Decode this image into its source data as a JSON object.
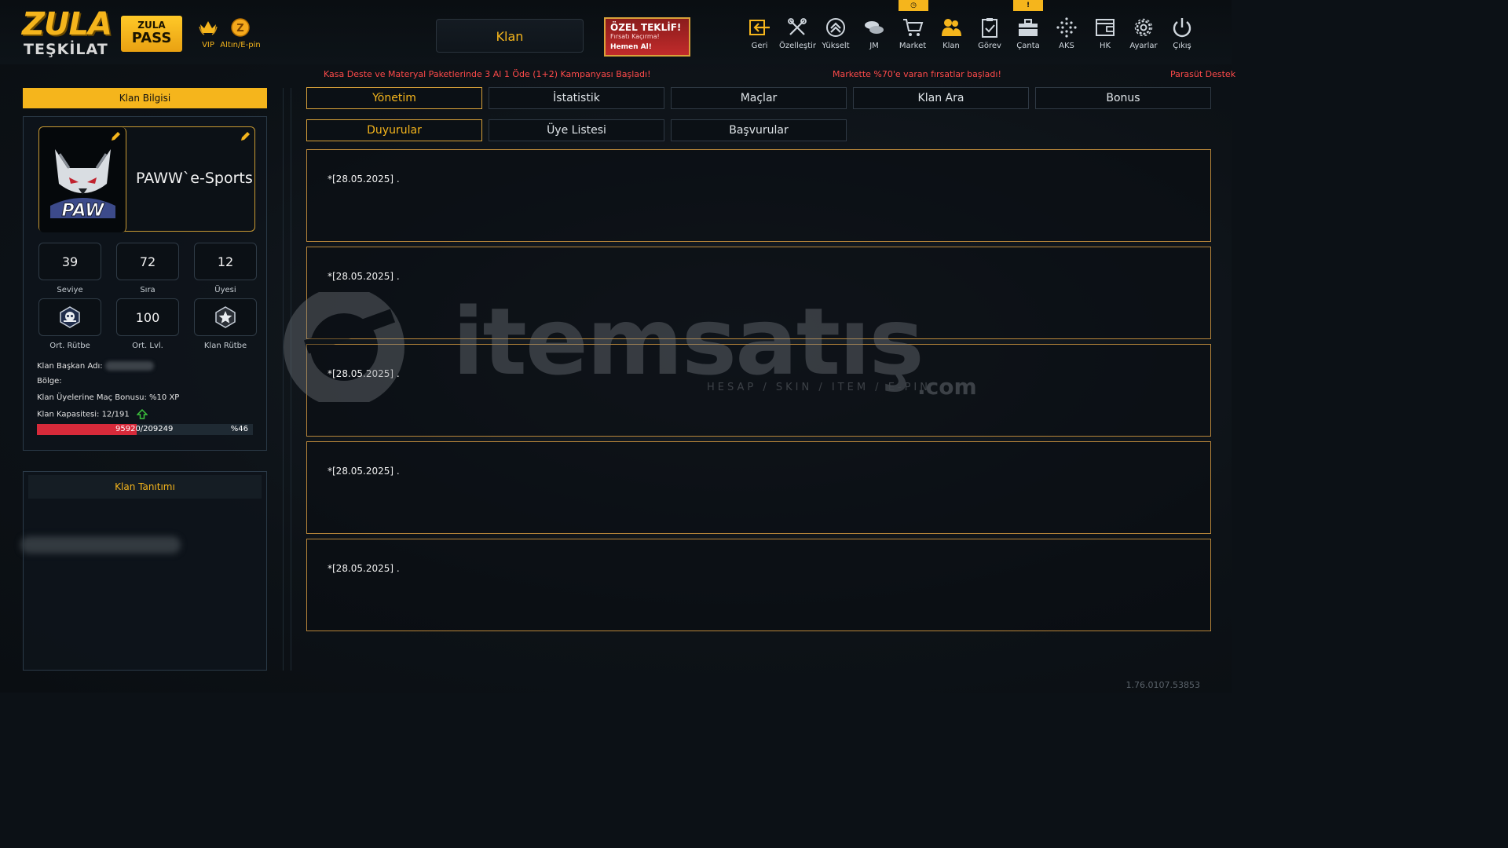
{
  "header": {
    "logo_line1": "ZULA",
    "logo_line2": "TEŞKİLAT",
    "zula_pass_line1": "ZULA",
    "zula_pass_line2": "PASS",
    "vip_label": "VIP",
    "gold_label": "Altın/E-pin",
    "page_title": "Klan",
    "offer_title": "ÖZEL TEKLİF!",
    "offer_subtitle": "Fırsatı Kaçırma!",
    "offer_cta": "Hemen Al!",
    "nav": [
      {
        "label": "Geri",
        "icon": "back-arrow-icon"
      },
      {
        "label": "Özelleştir",
        "icon": "tools-icon"
      },
      {
        "label": "Yükselt",
        "icon": "rank-up-icon"
      },
      {
        "label": "JM",
        "icon": "coins-icon"
      },
      {
        "label": "Market",
        "icon": "cart-icon"
      },
      {
        "label": "Klan",
        "icon": "clan-icon"
      },
      {
        "label": "Görev",
        "icon": "clipboard-icon"
      },
      {
        "label": "Çanta",
        "icon": "bag-icon"
      },
      {
        "label": "AKS",
        "icon": "dots-icon"
      },
      {
        "label": "HK",
        "icon": "wallet-icon"
      },
      {
        "label": "Ayarlar",
        "icon": "gear-icon"
      },
      {
        "label": "Çıkış",
        "icon": "power-icon"
      }
    ],
    "badge_market": "◷",
    "badge_canta": "!"
  },
  "ticker": {
    "msg1": "Kasa Deste ve Materyal Paketlerinde 3 Al 1 Öde (1+2) Kampanyası Başladı!",
    "msg2": "Markette %70'e varan fırsatlar başladı!",
    "msg3": "Parasüt Destek"
  },
  "clan_info": {
    "header": "Klan Bilgisi",
    "name": "PAWW`e-Sports",
    "level": "39",
    "level_label": "Seviye",
    "rank": "72",
    "rank_label": "Sıra",
    "members": "12",
    "members_label": "Üyesi",
    "avg_rank_label": "Ort. Rütbe",
    "avg_level": "100",
    "avg_level_label": "Ort. Lvl.",
    "clan_rank_label": "Klan Rütbe",
    "leader_label": "Klan Başkan Adı:",
    "region_label": "Bölge:",
    "bonus_label": "Klan Üyelerine Maç Bonusu: %10 XP",
    "capacity_label": "Klan Kapasitesi: 12/191",
    "xp_progress": 0.46,
    "xp_text": "95920/209249",
    "xp_pct": "%46"
  },
  "clan_intro": {
    "header": "Klan Tanıtımı"
  },
  "tabs_row1": [
    {
      "label": "Yönetim",
      "active": true
    },
    {
      "label": "İstatistik",
      "active": false
    },
    {
      "label": "Maçlar",
      "active": false
    },
    {
      "label": "Klan Ara",
      "active": false
    },
    {
      "label": "Bonus",
      "active": false
    }
  ],
  "tabs_row2": [
    {
      "label": "Duyurular",
      "active": true
    },
    {
      "label": "Üye Listesi",
      "active": false
    },
    {
      "label": "Başvurular",
      "active": false
    }
  ],
  "announcements": [
    "*[28.05.2025] .",
    "*[28.05.2025] .",
    "*[28.05.2025] .",
    "*[28.05.2025] .",
    "*[28.05.2025] ."
  ],
  "watermark": {
    "brand": "itemsatış",
    "tagline": "HESAP / SKIN / ITEM / E-PIN",
    "suffix": ".com"
  },
  "version": "1.76.0107.53853",
  "colors": {
    "accent": "#f5b51c",
    "ticker_red": "#ff4a4a",
    "xp_fill": "#d72a3a",
    "border_gold": "#c89a33"
  }
}
